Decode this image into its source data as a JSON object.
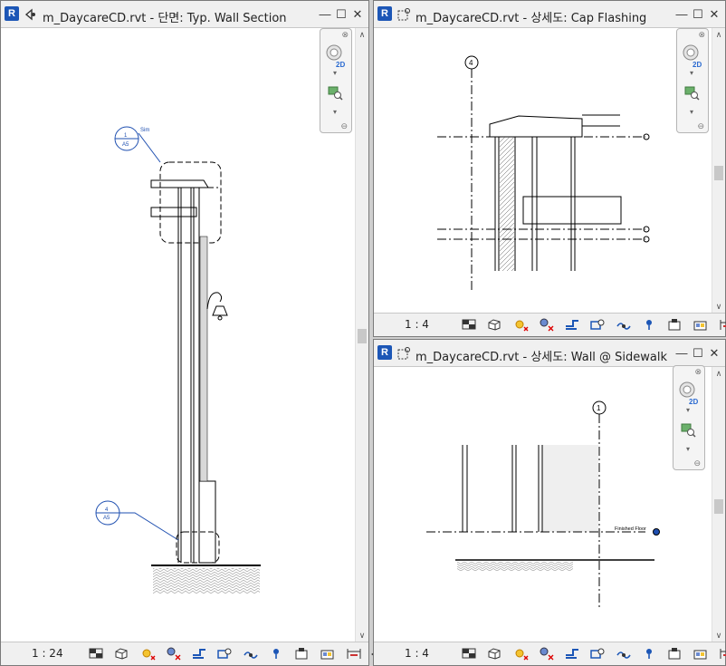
{
  "windows": {
    "left": {
      "app_badge": "R",
      "title": "m_DaycareCD.rvt - 단면: Typ. Wall Section",
      "scale": "1 : 24",
      "tags": [
        {
          "number": "1",
          "sheet": "A5",
          "note": "Sim"
        },
        {
          "number": "4",
          "sheet": "A5"
        }
      ]
    },
    "top_right": {
      "app_badge": "R",
      "title": "m_DaycareCD.rvt - 상세도: Cap Flashing",
      "scale": "1 : 4",
      "grid_label": "4"
    },
    "bottom_right": {
      "app_badge": "R",
      "title": "m_DaycareCD.rvt - 상세도: Wall @ Sidewalk",
      "scale": "1 : 4",
      "grid_label": "1",
      "level_label": "Finished Floor"
    }
  },
  "navbar": {
    "close": "⊗",
    "more": "▾",
    "minimize": "⊖",
    "wheel_label": "2D"
  },
  "window_buttons": {
    "min": "—",
    "max": "☐",
    "close": "✕"
  },
  "scroll": {
    "up": "∧",
    "down": "∨",
    "left": "<",
    "right": ">"
  },
  "icons": [
    "detail-level-icon",
    "visual-style-icon",
    "sun-path-icon",
    "shadows-icon",
    "crop-view-icon",
    "show-crop-icon",
    "temporary-hide-icon",
    "reveal-hidden-icon",
    "worksharing-icon",
    "design-options-icon",
    "analysis-icon",
    "constraints-icon"
  ],
  "colors": {
    "accent": "#1c56b6",
    "tag": "#1e4fb0",
    "line": "#000000"
  }
}
